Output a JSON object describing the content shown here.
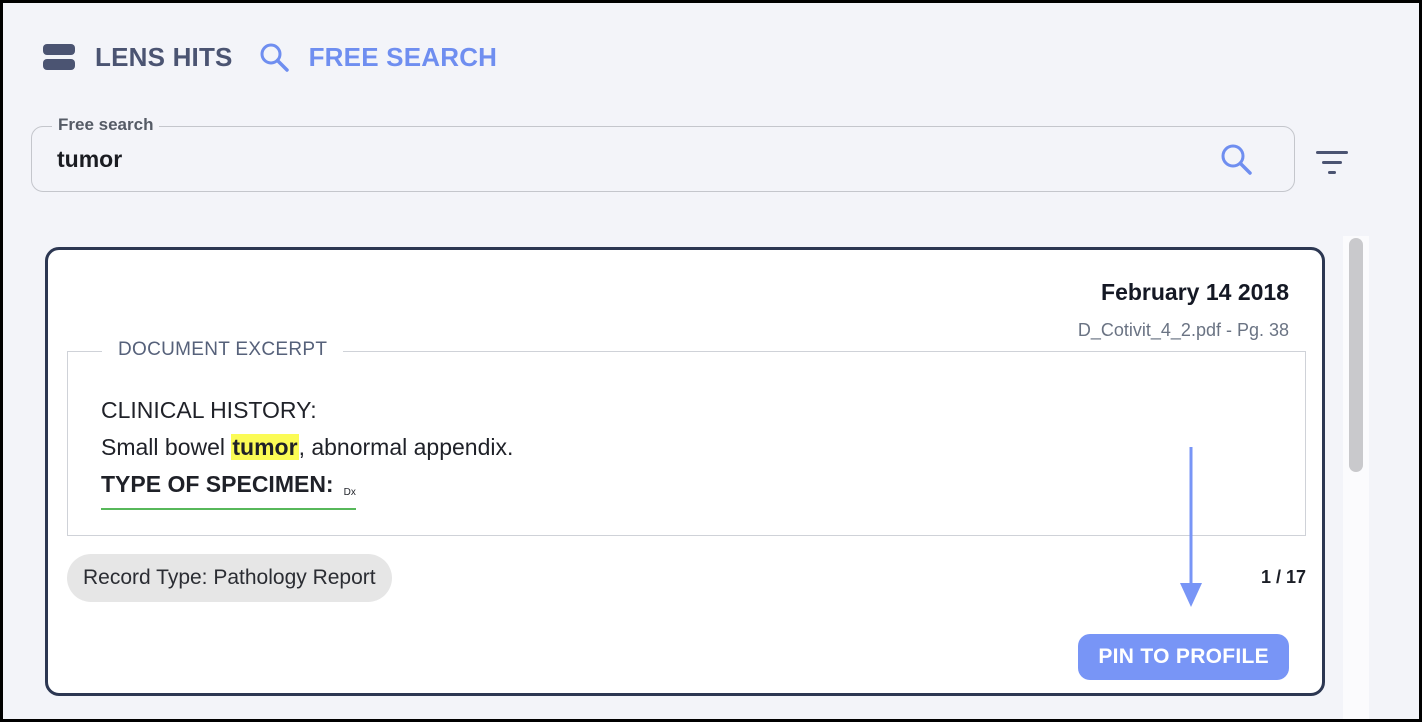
{
  "header": {
    "tabs": [
      {
        "label": "LENS HITS",
        "icon": "lens-hits-icon"
      },
      {
        "label": "FREE SEARCH",
        "icon": "search-icon"
      }
    ]
  },
  "search": {
    "legend": "Free search",
    "value": "tumor",
    "placeholder": ""
  },
  "result": {
    "date": "February 14 2018",
    "source": "D_Cotivit_4_2.pdf - Pg. 38",
    "excerpt_legend": "DOCUMENT EXCERPT",
    "excerpt": {
      "line1": "CLINICAL HISTORY:",
      "line2_before": "Small bowel ",
      "line2_highlight": "tumor",
      "line2_after": ", abnormal appendix.",
      "line3": "TYPE OF SPECIMEN:",
      "line3_tag": "Dx"
    },
    "record_type": "Record Type: Pathology Report",
    "counter": "1 / 17",
    "pin_label": "PIN TO PROFILE"
  },
  "colors": {
    "accent": "#7895f6",
    "card_border": "#2c3752",
    "highlight": "#fbfb55",
    "annotation_underline": "#57b85a"
  }
}
